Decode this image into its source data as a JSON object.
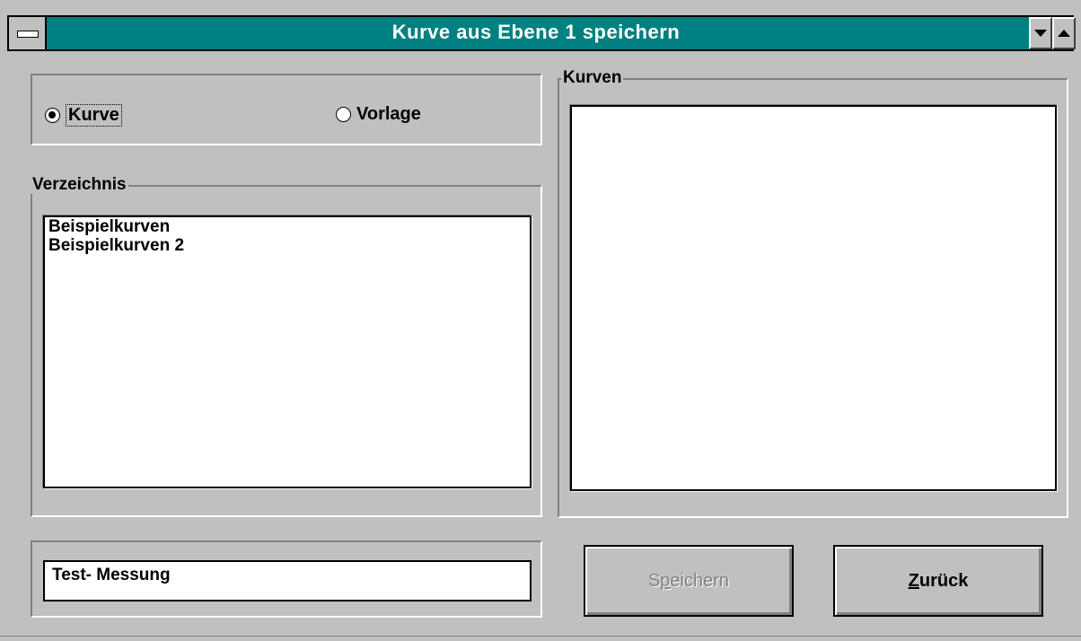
{
  "window": {
    "title": "Kurve  aus Ebene 1 speichern"
  },
  "mode": {
    "options": [
      {
        "label": "Kurve",
        "selected": true
      },
      {
        "label": "Vorlage",
        "selected": false
      }
    ]
  },
  "directory": {
    "label": "Verzeichnis",
    "items": [
      "Beispielkurven",
      "Beispielkurven 2"
    ]
  },
  "curves": {
    "label": "Kurven",
    "items": []
  },
  "name_field": {
    "value": "Test- Messung"
  },
  "buttons": {
    "save_accel": "S",
    "save_mid": "p",
    "save_rest": "eichern",
    "back_accel": "Z",
    "back_rest": "urück"
  },
  "colors": {
    "titlebar": "#008080",
    "face": "#c0c0c0"
  },
  "icons": {
    "system_menu": "system-menu-icon",
    "minimize": "minimize-arrow-icon",
    "maximize": "maximize-arrow-icon"
  }
}
